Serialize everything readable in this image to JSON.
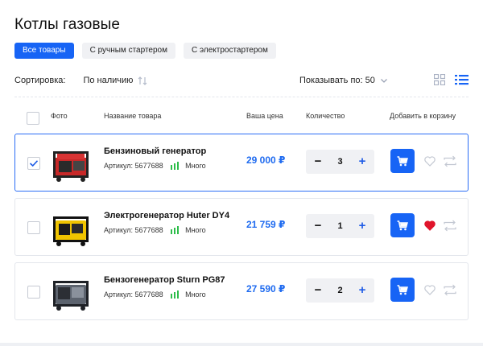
{
  "page": {
    "title": "Котлы газовые"
  },
  "filters": [
    {
      "label": "Все товары",
      "active": true
    },
    {
      "label": "С ручным стартером",
      "active": false
    },
    {
      "label": "С электростартером",
      "active": false
    }
  ],
  "sort": {
    "label": "Сортировка:",
    "value": "По наличию",
    "per_page_label": "Показывать по: 50"
  },
  "table": {
    "columns": {
      "photo": "Фото",
      "name": "Название товара",
      "price": "Ваша цена",
      "quantity": "Количество",
      "cart": "Добавить в корзину"
    }
  },
  "products": [
    {
      "name": "Бензиновый генератор",
      "sku": "Артикул: 5677688",
      "stock": "Много",
      "price": "29 000 ₽",
      "quantity": "3",
      "checked": true,
      "favorite": false
    },
    {
      "name": "Электрогенератор Huter DY4",
      "sku": "Артикул: 5677688",
      "stock": "Много",
      "price": "21 759 ₽",
      "quantity": "1",
      "checked": false,
      "favorite": true
    },
    {
      "name": "Бензогенератор Sturn PG87",
      "sku": "Артикул: 5677688",
      "stock": "Много",
      "price": "27 590 ₽",
      "quantity": "2",
      "checked": false,
      "favorite": false
    }
  ],
  "colors": {
    "accent": "#1764f5",
    "price": "#1f6bf0",
    "stock": "#2dbd4a",
    "favorite_active": "#e0142b",
    "chip_bg": "#f0f1f4"
  },
  "icons": {
    "sort": "sort-arrows-icon",
    "per_page": "chevron-down-icon",
    "grid_view": "grid-view-icon",
    "list_view": "list-view-icon",
    "cart": "cart-icon",
    "favorite": "heart-icon",
    "compare": "compare-arrows-icon",
    "stock": "stock-bars-icon"
  }
}
